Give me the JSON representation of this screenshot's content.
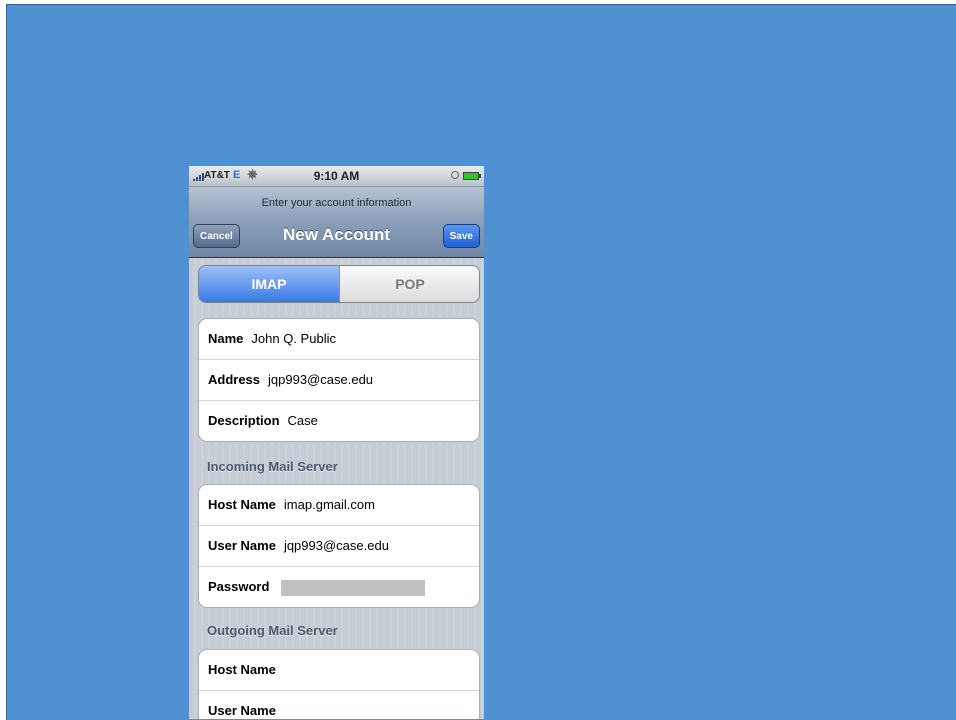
{
  "status_bar": {
    "carrier": "AT&T",
    "network": "E",
    "time": "9:10 AM"
  },
  "nav": {
    "prompt": "Enter your account information",
    "title": "New Account",
    "cancel_label": "Cancel",
    "save_label": "Save"
  },
  "protocol_tabs": [
    {
      "label": "IMAP",
      "selected": true
    },
    {
      "label": "POP",
      "selected": false
    }
  ],
  "account": {
    "name_label": "Name",
    "name_value": "John Q. Public",
    "address_label": "Address",
    "address_value": "jqp993@case.edu",
    "description_label": "Description",
    "description_value": "Case"
  },
  "incoming": {
    "header": "Incoming Mail Server",
    "host_label": "Host Name",
    "host_value": "imap.gmail.com",
    "user_label": "User Name",
    "user_value": "jqp993@case.edu",
    "password_label": "Password"
  },
  "outgoing": {
    "header": "Outgoing Mail Server",
    "host_label": "Host Name",
    "user_label": "User Name"
  },
  "colors": {
    "background": "#5091d1",
    "selected_tab": "#3b7ae6",
    "save_button": "#1f5fd6"
  }
}
